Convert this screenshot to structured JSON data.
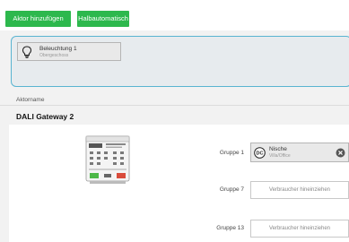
{
  "toolbar": {
    "add_actuator_label": "Aktor hinzufügen",
    "semi_auto_label": "Halbautomatisch",
    "accent_color": "#2db84d"
  },
  "assigned": {
    "item": {
      "title": "Beleuchtung 1",
      "subtitle": "Obergeschoss",
      "icon": "lightbulb-icon"
    }
  },
  "table": {
    "column_header": "Aktorname"
  },
  "gateway": {
    "title": "DALI Gateway 2",
    "groups": [
      {
        "label": "Gruppe 1",
        "filled": true,
        "title": "Nische",
        "subtitle": "Villa/Office",
        "icon": "dc-icon"
      },
      {
        "label": "Gruppe 7",
        "filled": false,
        "placeholder": "Verbraucher hineinziehen"
      },
      {
        "label": "Gruppe 13",
        "filled": false,
        "placeholder": "Verbraucher hineinziehen"
      }
    ]
  }
}
